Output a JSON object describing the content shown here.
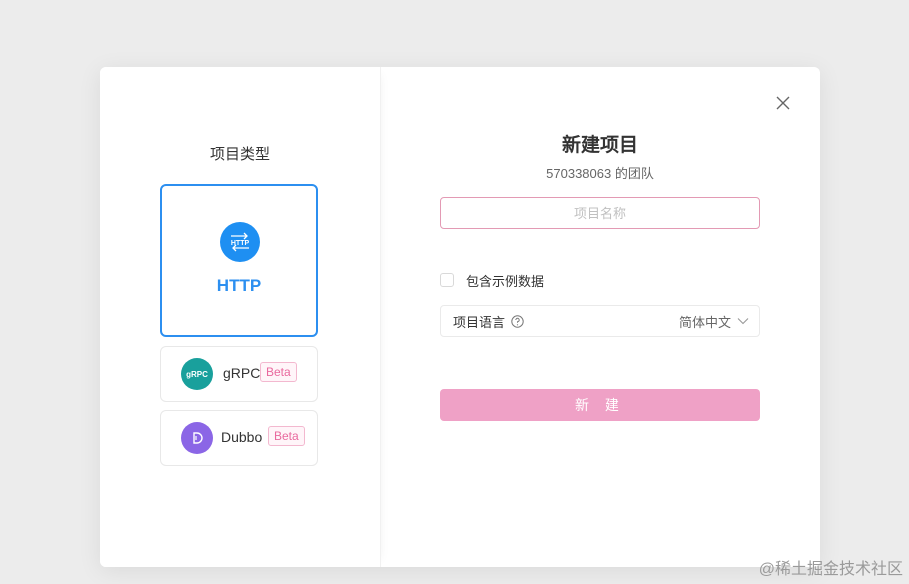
{
  "left_panel": {
    "title": "项目类型",
    "types": [
      {
        "label": "HTTP",
        "icon": "http-icon",
        "selected": true
      },
      {
        "label": "gRPC",
        "icon": "grpc-icon",
        "icon_text": "gRPC",
        "badge": "Beta"
      },
      {
        "label": "Dubbo",
        "icon": "dubbo-icon",
        "icon_text": "D",
        "badge": "Beta"
      }
    ]
  },
  "right_panel": {
    "title": "新建项目",
    "subtitle": "570338063 的团队",
    "name_placeholder": "项目名称",
    "include_sample_label": "包含示例数据",
    "language_label": "项目语言",
    "language_value": "简体中文",
    "create_label": "新 建"
  },
  "watermark": "@稀土掘金技术社区",
  "colors": {
    "accent_blue": "#2c8ff0",
    "create_pink": "#efa1c6",
    "beta_pink": "#e9699e",
    "grpc_teal": "#19a09c",
    "dubbo_purple": "#8b66e6"
  }
}
